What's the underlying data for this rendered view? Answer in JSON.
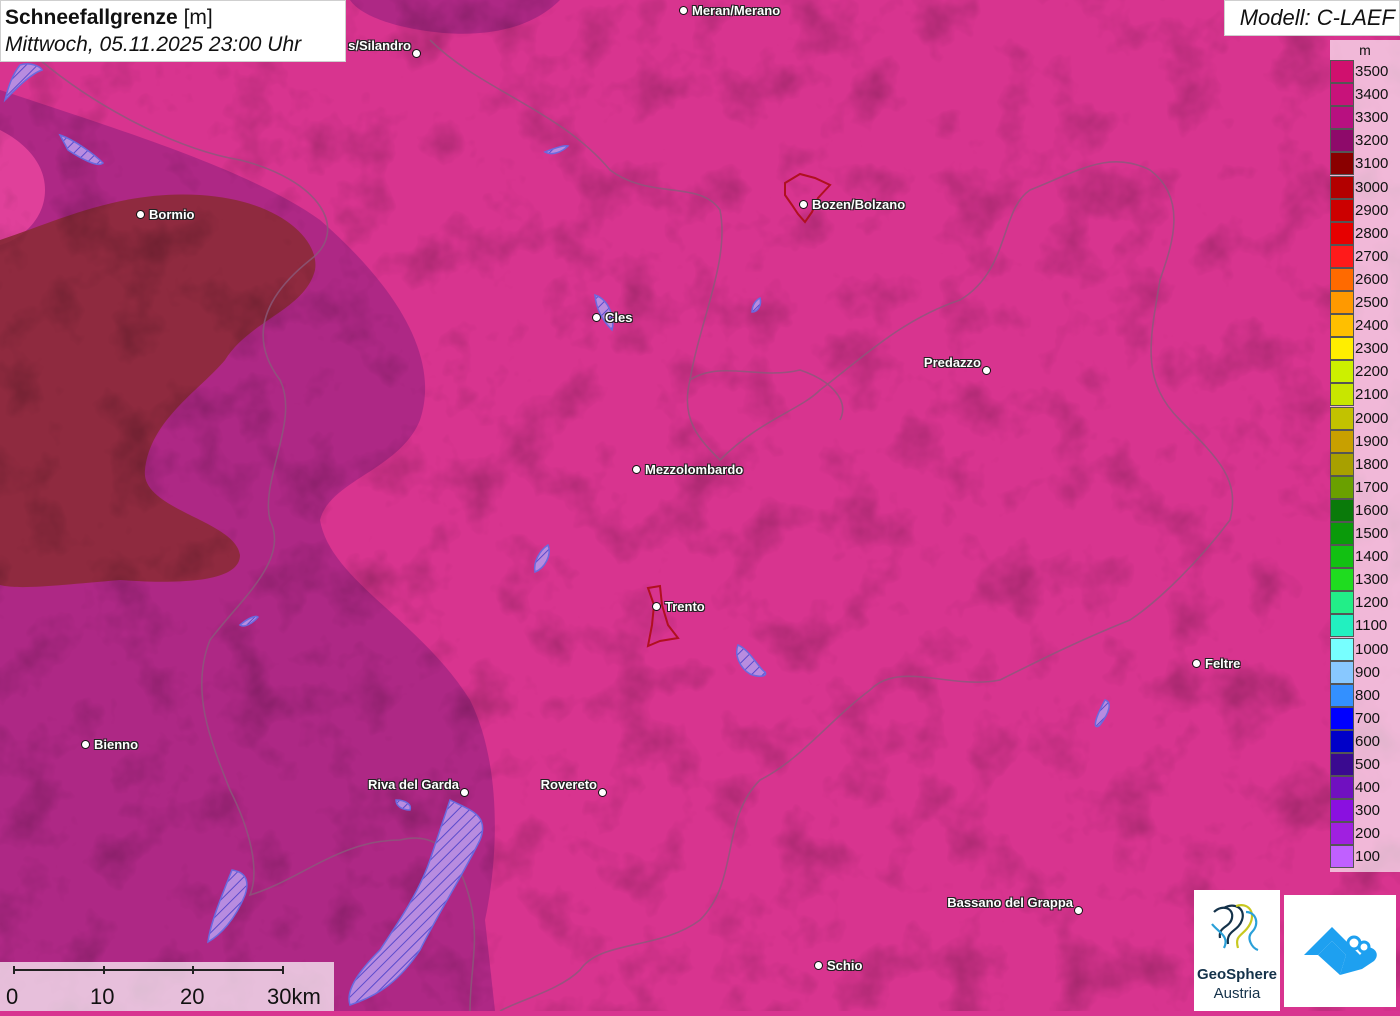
{
  "title": {
    "main": "Schneefallgrenze",
    "unit": "[m]",
    "datetime": "Mittwoch, 05.11.2025 23:00 Uhr"
  },
  "model": "Modell: C-LAEF",
  "legend": {
    "unit": "m",
    "entries": [
      {
        "label": "3500",
        "color": "#d0106e"
      },
      {
        "label": "3400",
        "color": "#c8127a"
      },
      {
        "label": "3300",
        "color": "#b81080"
      },
      {
        "label": "3200",
        "color": "#8e0a6a"
      },
      {
        "label": "3100",
        "color": "#8a0000"
      },
      {
        "label": "3000",
        "color": "#b30000"
      },
      {
        "label": "2900",
        "color": "#cc0000"
      },
      {
        "label": "2800",
        "color": "#e60000"
      },
      {
        "label": "2700",
        "color": "#ff1a1a"
      },
      {
        "label": "2600",
        "color": "#ff6a00"
      },
      {
        "label": "2500",
        "color": "#ff9900"
      },
      {
        "label": "2400",
        "color": "#ffbf00"
      },
      {
        "label": "2300",
        "color": "#ffee00"
      },
      {
        "label": "2200",
        "color": "#ccf000"
      },
      {
        "label": "2100",
        "color": "#c8e600"
      },
      {
        "label": "2000",
        "color": "#c2c200"
      },
      {
        "label": "1900",
        "color": "#c8a000"
      },
      {
        "label": "1800",
        "color": "#a8a000"
      },
      {
        "label": "1700",
        "color": "#6aa000"
      },
      {
        "label": "1600",
        "color": "#0a7a0a"
      },
      {
        "label": "1500",
        "color": "#0a9a0a"
      },
      {
        "label": "1400",
        "color": "#12c012"
      },
      {
        "label": "1300",
        "color": "#1fdc1f"
      },
      {
        "label": "1200",
        "color": "#22ee88"
      },
      {
        "label": "1100",
        "color": "#22f0c0"
      },
      {
        "label": "1000",
        "color": "#77ffff"
      },
      {
        "label": "900",
        "color": "#88c8ff"
      },
      {
        "label": "800",
        "color": "#3390ff"
      },
      {
        "label": "700",
        "color": "#0000ff"
      },
      {
        "label": "600",
        "color": "#0000c8"
      },
      {
        "label": "500",
        "color": "#3a0a90"
      },
      {
        "label": "400",
        "color": "#7010c0"
      },
      {
        "label": "300",
        "color": "#8a10e0"
      },
      {
        "label": "200",
        "color": "#a020e0"
      },
      {
        "label": "100",
        "color": "#c060ff"
      }
    ]
  },
  "cities": [
    {
      "name": "Meran/Merano"
    },
    {
      "name": "s/Silandro"
    },
    {
      "name": "Bormio"
    },
    {
      "name": "Bozen/Bolzano"
    },
    {
      "name": "Cles"
    },
    {
      "name": "Predazzo"
    },
    {
      "name": "Mezzolombardo"
    },
    {
      "name": "Trento"
    },
    {
      "name": "Feltre"
    },
    {
      "name": "Bienno"
    },
    {
      "name": "Riva del Garda"
    },
    {
      "name": "Rovereto"
    },
    {
      "name": "Bassano del Grappa"
    },
    {
      "name": "Schio"
    }
  ],
  "scale": {
    "labels": [
      "0",
      "10",
      "20",
      "30km"
    ]
  },
  "logos": {
    "geosphere_line1": "GeoSphere",
    "geosphere_line2": "Austria"
  }
}
